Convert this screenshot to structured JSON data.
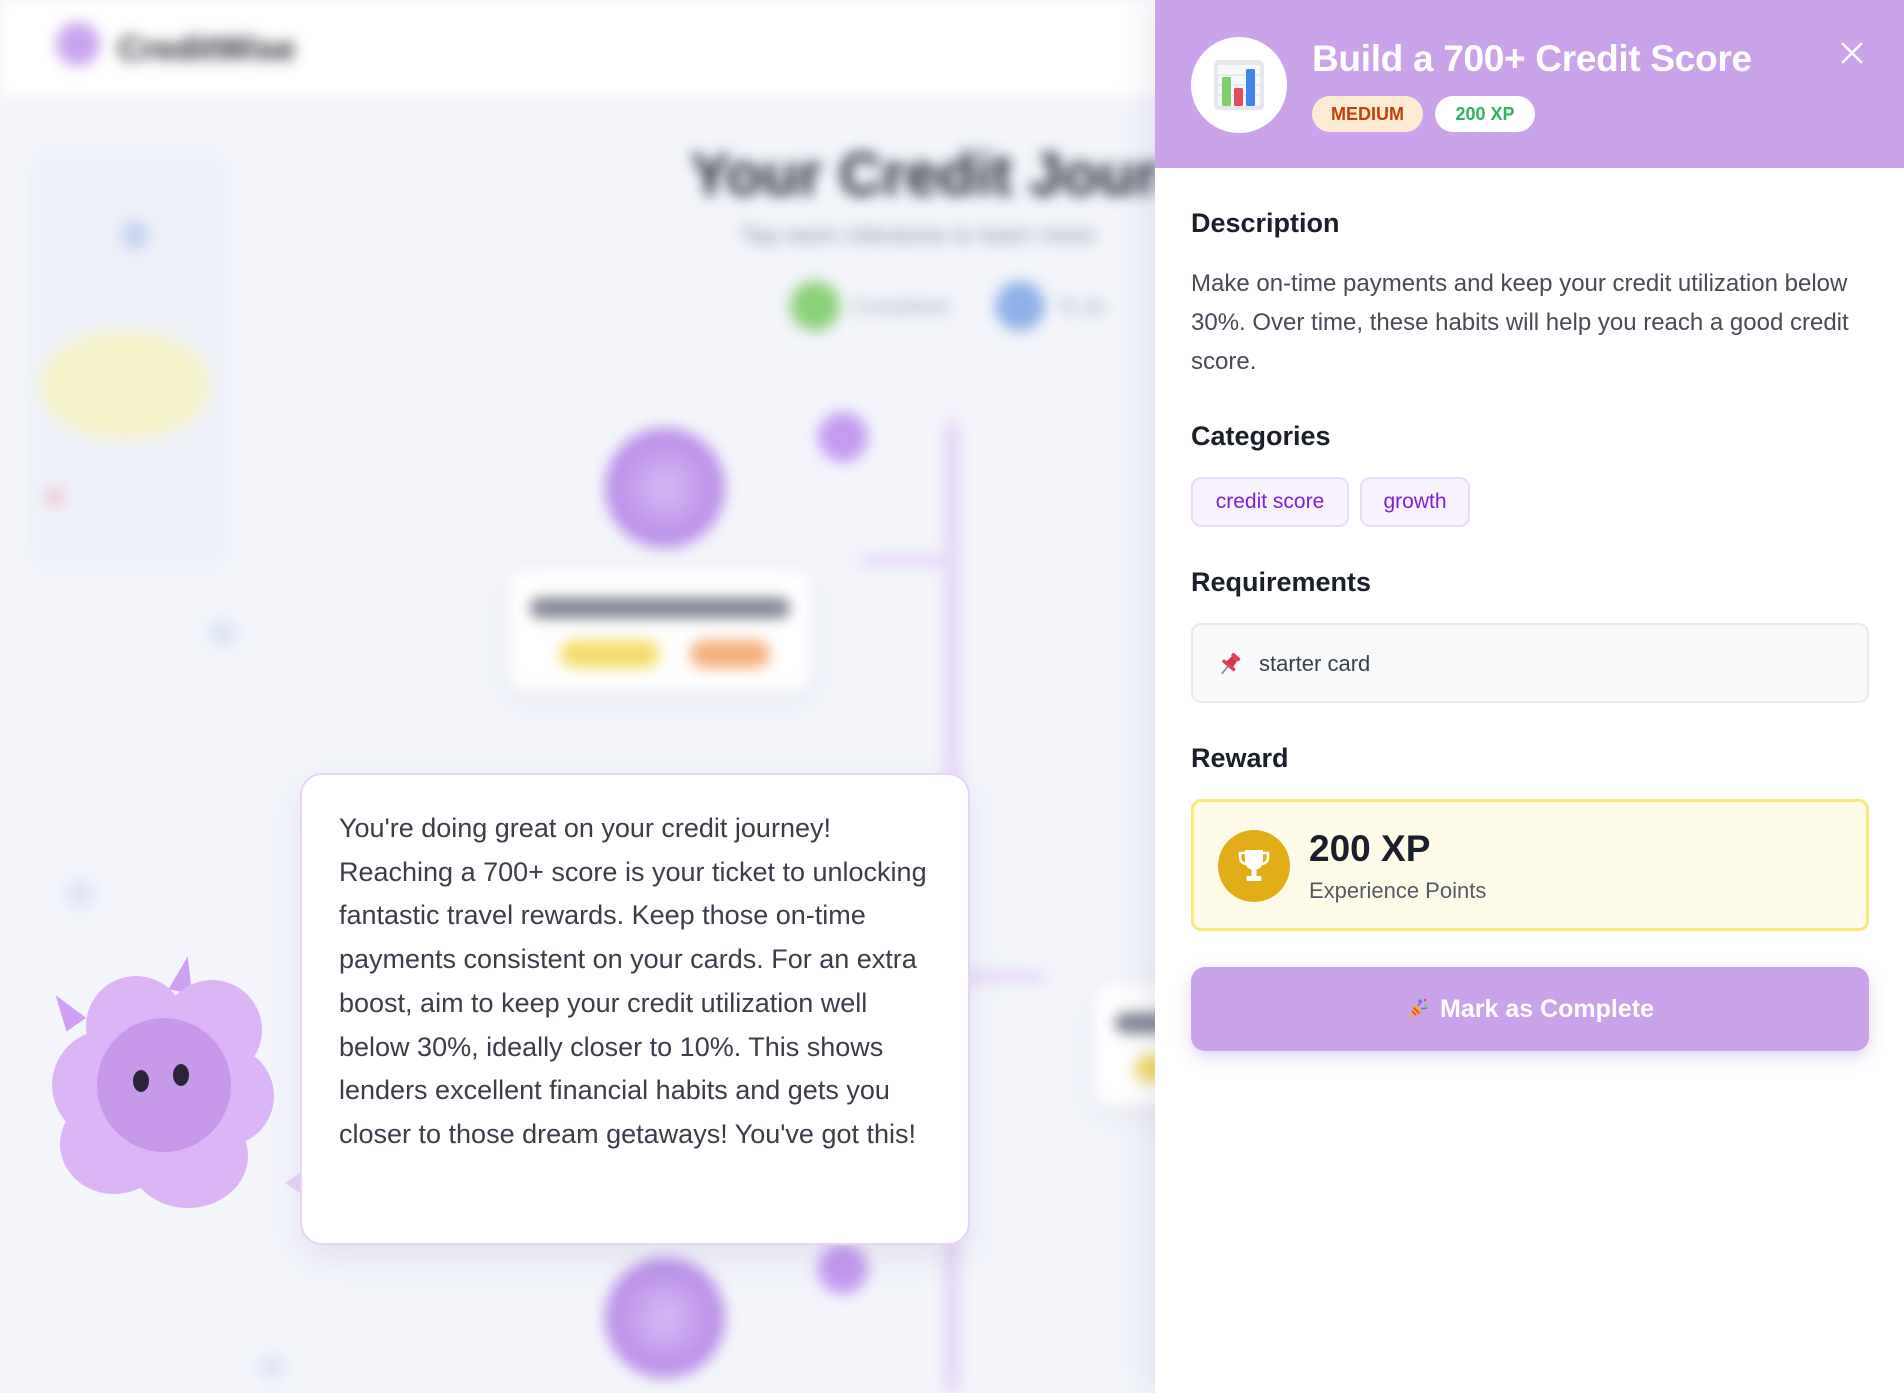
{
  "background": {
    "app_name": "CreditWise",
    "page_title": "Your Credit Journey",
    "page_subtitle": "Tap each milestone to learn more",
    "legend": [
      {
        "label": "Completed",
        "color": "#8bd17a"
      },
      {
        "label": "To do",
        "color": "#8fb2e8"
      }
    ],
    "card_chip_colors": [
      "#f5dc6b",
      "#f3b07a"
    ]
  },
  "mascot": {
    "message": "You're doing great on your credit journey! Reaching a 700+ score is your ticket to unlocking fantastic travel rewards. Keep those on-time payments consistent on your cards. For an extra boost, aim to keep your credit utilization well below 30%, ideally closer to 10%. This shows lenders excellent financial habits and gets you closer to those dream getaways! You've got this!"
  },
  "panel": {
    "title": "Build a 700+ Credit Score",
    "icon": "bar-chart-icon",
    "difficulty": "MEDIUM",
    "xp_badge": "200 XP",
    "close_icon": "close-icon",
    "description_heading": "Description",
    "description": "Make on-time payments and keep your credit utilization below 30%. Over time, these habits will help you reach a good credit score.",
    "categories_heading": "Categories",
    "categories": [
      "credit score",
      "growth"
    ],
    "requirements_heading": "Requirements",
    "requirements": [
      {
        "icon": "pushpin-icon",
        "label": "starter card"
      }
    ],
    "reward_heading": "Reward",
    "reward": {
      "icon": "trophy-icon",
      "amount": "200 XP",
      "label": "Experience Points"
    },
    "complete_button": {
      "icon": "party-popper-icon",
      "label": "Mark as Complete"
    }
  },
  "colors": {
    "header_accent": "#cba3ea",
    "difficulty_bg": "#fdecd3",
    "difficulty_text": "#c2410c",
    "xp_text": "#2fb35e",
    "tag_text": "#7e22ce",
    "reward_bg": "#fefce8",
    "reward_border": "#f7e97a",
    "trophy_bg": "#e2ae18"
  }
}
